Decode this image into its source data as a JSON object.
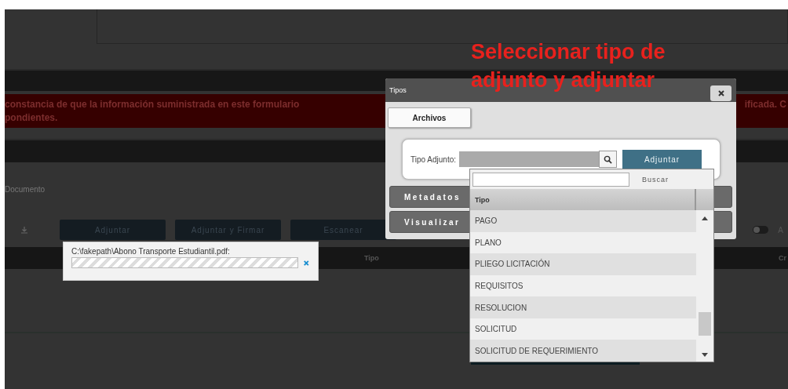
{
  "page": {
    "banner": {
      "line_1": "constancia de que la información suministrada en este formulario",
      "line_1_end": "ificada. C",
      "line_2": "pondientes."
    },
    "document_label": "Documento",
    "toolbar": {
      "buttons": [
        "Adjuntar",
        "Adjuntar y Firmar",
        "Escanear"
      ],
      "toggle": {
        "on": false,
        "label": "A"
      }
    },
    "table": {
      "columns": [
        "Tipo",
        "Cr"
      ]
    }
  },
  "upload": {
    "file": "C:\\fakepath\\Abono Transporte Estudiantil.pdf:",
    "level": 1
  },
  "dialog": {
    "title": "Tipos",
    "tabs": [
      {
        "label": "Archivos",
        "selected": true
      }
    ],
    "field_label": "Tipo Adjunto:",
    "button": "Adjuntar",
    "sections": [
      "Metadatos",
      "Visualizar"
    ]
  },
  "dropdown": {
    "search_button": "Buscar",
    "column": "Tipo",
    "rows": [
      "PAGO",
      "PLANO",
      "PLIEGO LICITACIÓN",
      "REQUISITOS",
      "RESOLUCION",
      "SOLICITUD",
      "SOLICITUD DE REQUERIMIENTO"
    ]
  },
  "annotation": {
    "lines": [
      "Seleccionar tipo de",
      "adjunto y adjuntar"
    ]
  }
}
